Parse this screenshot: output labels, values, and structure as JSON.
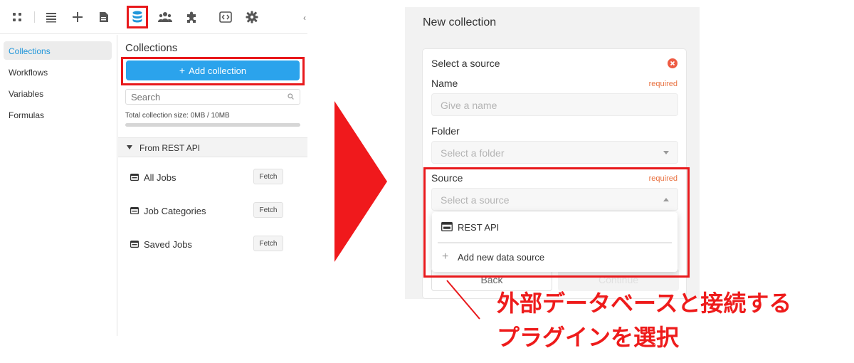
{
  "toolbar": {
    "icons": [
      "grid-icon",
      "list-icon",
      "plus-icon",
      "document-icon",
      "database-icon",
      "users-icon",
      "puzzle-icon",
      "code-icon",
      "gear-icon"
    ],
    "more": "‹"
  },
  "sidebar": {
    "items": [
      {
        "label": "Collections",
        "active": true
      },
      {
        "label": "Workflows",
        "active": false
      },
      {
        "label": "Variables",
        "active": false
      },
      {
        "label": "Formulas",
        "active": false
      }
    ]
  },
  "collections": {
    "title": "Collections",
    "add_button": "Add collection",
    "search_placeholder": "Search",
    "size_text": "Total collection size: 0MB / 10MB",
    "size_used_fraction": 0,
    "group_label": "From REST API",
    "rows": [
      {
        "label": "All Jobs",
        "action": "Fetch"
      },
      {
        "label": "Job Categories",
        "action": "Fetch"
      },
      {
        "label": "Saved Jobs",
        "action": "Fetch"
      }
    ]
  },
  "new_collection": {
    "title": "New collection",
    "card_title": "Select a source",
    "name_label": "Name",
    "name_required": "required",
    "name_placeholder": "Give a name",
    "folder_label": "Folder",
    "folder_placeholder": "Select a folder",
    "source_label": "Source",
    "source_required": "required",
    "source_placeholder": "Select a source",
    "back_button": "Back",
    "continue_button": "Continue",
    "dropdown": {
      "option_rest": "REST API",
      "option_add": "Add new data source"
    }
  },
  "annotation": {
    "line1": "外部データベースと接続する",
    "line2": "プラグインを選択"
  },
  "colors": {
    "accent": "#2ba3ec",
    "highlight": "#e8191c",
    "required": "#e8703f",
    "caption": "#ee1b1b"
  }
}
